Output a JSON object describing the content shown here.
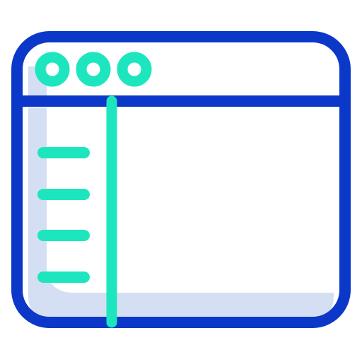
{
  "icon": {
    "name": "browser-window-sidebar-icon",
    "colors": {
      "outline": "#0B38C9",
      "accent": "#1DE6BF",
      "shade": "#D4DFF3",
      "background": "#FFFFFF"
    },
    "window_control_dots": 3,
    "sidebar_lines": 4
  }
}
